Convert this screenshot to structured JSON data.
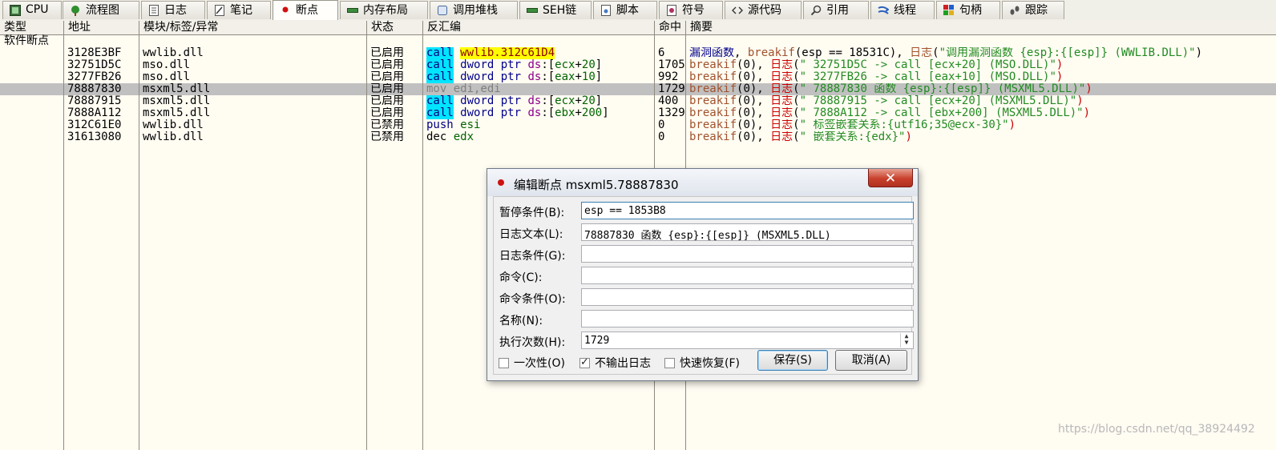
{
  "tabs": [
    {
      "label": "CPU",
      "icon": "cpu-icon"
    },
    {
      "label": "流程图",
      "icon": "tree-icon"
    },
    {
      "label": "日志",
      "icon": "log-icon"
    },
    {
      "label": "笔记",
      "icon": "notes-icon"
    },
    {
      "label": "断点",
      "icon": "breakpoint-dot-icon"
    },
    {
      "label": "内存布局",
      "icon": "memory-icon"
    },
    {
      "label": "调用堆栈",
      "icon": "callstack-icon"
    },
    {
      "label": "SEH链",
      "icon": "seh-icon"
    },
    {
      "label": "脚本",
      "icon": "script-icon"
    },
    {
      "label": "符号",
      "icon": "symbol-icon"
    },
    {
      "label": "源代码",
      "icon": "source-icon"
    },
    {
      "label": "引用",
      "icon": "search-icon"
    },
    {
      "label": "线程",
      "icon": "thread-icon"
    },
    {
      "label": "句柄",
      "icon": "handle-icon"
    },
    {
      "label": "跟踪",
      "icon": "trace-icon"
    }
  ],
  "columns": {
    "type": "类型",
    "address": "地址",
    "module": "模块/标签/异常",
    "state": "状态",
    "disasm": "反汇编",
    "hits": "命中",
    "summary": "摘要"
  },
  "group_label": "软件断点",
  "rows": [
    {
      "address": "3128E3BF",
      "module": "wwlib.dll",
      "state": "已启用",
      "disasm": "call wwlib.312C61D4",
      "hits": "6",
      "summary": "漏洞函数, breakif(esp == 18531C), 日志(\"调用漏洞函数 {esp}:{[esp]} (WWLIB.DLL)\")"
    },
    {
      "address": "32751D5C",
      "module": "mso.dll",
      "state": "已启用",
      "disasm": "call dword ptr ds:[ecx+20]",
      "hits": "1705",
      "summary": "breakif(0), 日志(\" 32751D5C -> call [ecx+20] (MSO.DLL)\")"
    },
    {
      "address": "3277FB26",
      "module": "mso.dll",
      "state": "已启用",
      "disasm": "call dword ptr ds:[eax+10]",
      "hits": "992",
      "summary": "breakif(0), 日志(\" 3277FB26 -> call [eax+10] (MSO.DLL)\")"
    },
    {
      "address": "78887830",
      "module": "msxml5.dll",
      "state": "已启用",
      "disasm": "mov edi,edi",
      "hits": "1729",
      "summary": "breakif(0), 日志(\" 78887830 函数 {esp}:{[esp]} (MSXML5.DLL)\")"
    },
    {
      "address": "78887915",
      "module": "msxml5.dll",
      "state": "已启用",
      "disasm": "call dword ptr ds:[ecx+20]",
      "hits": "400",
      "summary": "breakif(0), 日志(\" 78887915 -> call [ecx+20] (MSXML5.DLL)\")"
    },
    {
      "address": "7888A112",
      "module": "msxml5.dll",
      "state": "已启用",
      "disasm": "call dword ptr ds:[ebx+200]",
      "hits": "1329",
      "summary": "breakif(0), 日志(\" 7888A112 -> call [ebx+200] (MSXML5.DLL)\")"
    },
    {
      "address": "312C61E0",
      "module": "wwlib.dll",
      "state": "已禁用",
      "disasm": "push esi",
      "hits": "0",
      "summary": "breakif(0), 日志(\" 标签嵌套关系:{utf16;35@ecx-30}\")"
    },
    {
      "address": "31613080",
      "module": "wwlib.dll",
      "state": "已禁用",
      "disasm": "dec edx",
      "hits": "0",
      "summary": "breakif(0), 日志(\"  嵌套关系:{edx}\")"
    }
  ],
  "dialog": {
    "title": "编辑断点 msxml5.78887830",
    "close_label": "✕",
    "fields": [
      {
        "label": "暂停条件(B):",
        "value": "esp == 1853B8"
      },
      {
        "label": "日志文本(L):",
        "value": " 78887830 函数 {esp}:{[esp]} (MSXML5.DLL)"
      },
      {
        "label": "日志条件(G):",
        "value": ""
      },
      {
        "label": "命令(C):",
        "value": ""
      },
      {
        "label": "命令条件(O):",
        "value": ""
      },
      {
        "label": "名称(N):",
        "value": ""
      },
      {
        "label": "执行次数(H):",
        "value": "1729"
      }
    ],
    "checkboxes": [
      {
        "label": "一次性(O)",
        "checked": false
      },
      {
        "label": "不输出日志",
        "checked": true
      },
      {
        "label": "快速恢复(F)",
        "checked": false
      }
    ],
    "save_label": "保存(S)",
    "cancel_label": "取消(A)"
  },
  "watermark": "https://blog.csdn.net/qq_38924492",
  "colors": {
    "background": "#fffcf2",
    "selected_row": "#c0c0c0",
    "call_highlight": "#00e5ff",
    "label_highlight": "#ffff00",
    "close_button": "#c8402c"
  }
}
